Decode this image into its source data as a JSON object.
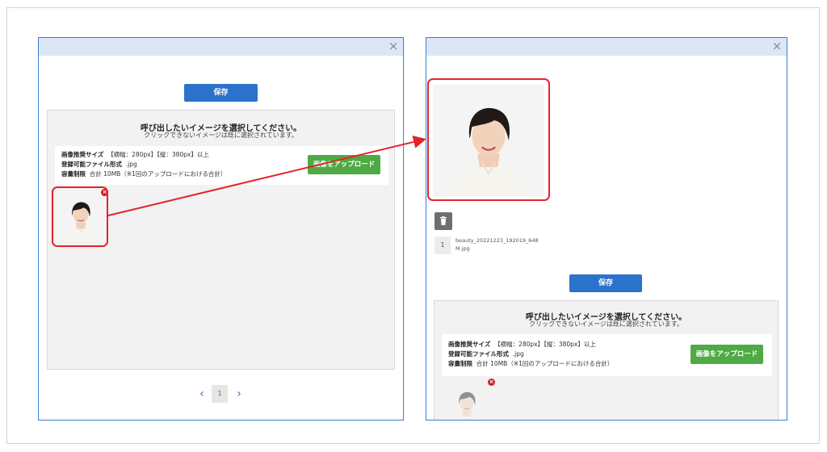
{
  "colors": {
    "accent": "#2b72cc",
    "upload": "#4faa45",
    "highlight": "#e3232c",
    "header": "#dce7f6"
  },
  "icons": {
    "close": "close-icon",
    "remove": "remove-icon",
    "trash": "trash-icon",
    "prev": "chevron-left-icon",
    "next": "chevron-right-icon"
  },
  "left_dialog": {
    "close_glyph": "×",
    "save_label": "保存",
    "panel": {
      "title": "呼び出したいイメージを選択してください。",
      "subtitle": "クリックできないイメージは既に選択されています。",
      "size_label": "画像推奨サイズ",
      "size_value": "【横幅：280px】【縦：380px】以上",
      "format_label": "登録可能ファイル形式",
      "format_value": ".jpg",
      "capacity_label": "容量制限",
      "capacity_value": "合計 10MB（※1回のアップロードにおける合計）",
      "upload_label": "画像をアップロード"
    },
    "remove_glyph": "×",
    "pagination": {
      "prev": "‹",
      "page": "1",
      "next": "›"
    }
  },
  "right_dialog": {
    "close_glyph": "×",
    "file": {
      "index": "1",
      "name": "beauty_20221223_192019_648 M.jpg"
    },
    "save_label": "保存",
    "panel": {
      "title": "呼び出したいイメージを選択してください。",
      "subtitle": "クリックできないイメージは既に選択されています。",
      "size_label": "画像推奨サイズ",
      "size_value": "【横幅：280px】【縦：380px】以上",
      "format_label": "登録可能ファイル形式",
      "format_value": ".jpg",
      "capacity_label": "容量制限",
      "capacity_value": "合計 10MB（※1回のアップロードにおける合計）",
      "upload_label": "画像をアップロード"
    },
    "remove_glyph": "×"
  }
}
